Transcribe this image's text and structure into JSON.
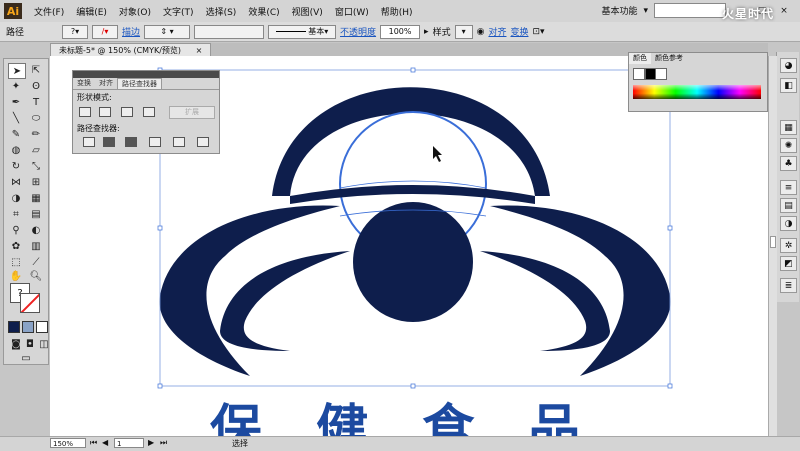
{
  "app": {
    "logo": "Ai",
    "workspace": "基本功能",
    "watermark": "火星时代"
  },
  "menu": [
    "文件(F)",
    "编辑(E)",
    "对象(O)",
    "文字(T)",
    "选择(S)",
    "效果(C)",
    "视图(V)",
    "窗口(W)",
    "帮助(H)"
  ],
  "control_bar": {
    "object_type": "路径",
    "stroke_label": "描边",
    "stroke_style": "基本",
    "opacity_label": "不透明度",
    "opacity_value": "100%",
    "style_label": "样式",
    "align_label": "对齐",
    "transform_label": "变换"
  },
  "document_tab": {
    "title": "未标题-5* @ 150% (CMYK/预览)",
    "close": "×"
  },
  "pathfinder_panel": {
    "tabs": [
      "变换",
      "对齐",
      "路径查找器"
    ],
    "active_tab": "路径查找器",
    "shape_modes_label": "形状模式:",
    "pathfinders_label": "路径查找器:",
    "expand_button": "扩展"
  },
  "color_panel": {
    "tabs": [
      "颜色",
      "颜色参考"
    ],
    "active_tab": "颜色"
  },
  "canvas_text": "保 健 食 品",
  "status_bar": {
    "zoom": "150%",
    "page": "1",
    "tool": "选择"
  },
  "colors": {
    "logo_fill": "#0e1e4c",
    "selection": "#3a6ed8",
    "ai_logo_bg": "#3a2b1c"
  }
}
